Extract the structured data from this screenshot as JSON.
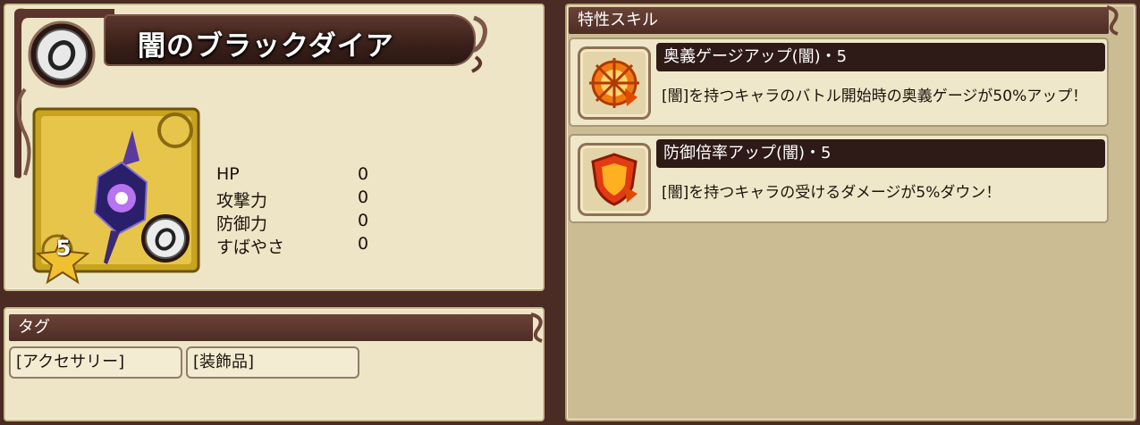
{
  "item": {
    "name": "闇のブラックダイア",
    "rarity": "5",
    "stats": [
      {
        "label": "HP",
        "value": "0"
      },
      {
        "label": "攻撃力",
        "value": "0"
      },
      {
        "label": "防御力",
        "value": "0"
      },
      {
        "label": "すばやさ",
        "value": "0"
      }
    ]
  },
  "tags": {
    "header": "タグ",
    "items": [
      "[アクセサリー]",
      "[装飾品]"
    ]
  },
  "skills": {
    "header": "特性スキル",
    "items": [
      {
        "name": "奥義ゲージアップ(闇)・5",
        "desc": "[闇]を持つキャラのバトル開始時の奥義ゲージが50%アップ！",
        "icon": "ougi-gauge-up-icon"
      },
      {
        "name": "防御倍率アップ(闇)・5",
        "desc": "[闇]を持つキャラの受けるダメージが5%ダウン！",
        "icon": "defense-shield-up-icon"
      }
    ]
  },
  "colors": {
    "page_background": "#4a2c24",
    "panel": "#ede5c6",
    "header": "#5a362d",
    "skill_name_bar": "#2e1a16"
  }
}
